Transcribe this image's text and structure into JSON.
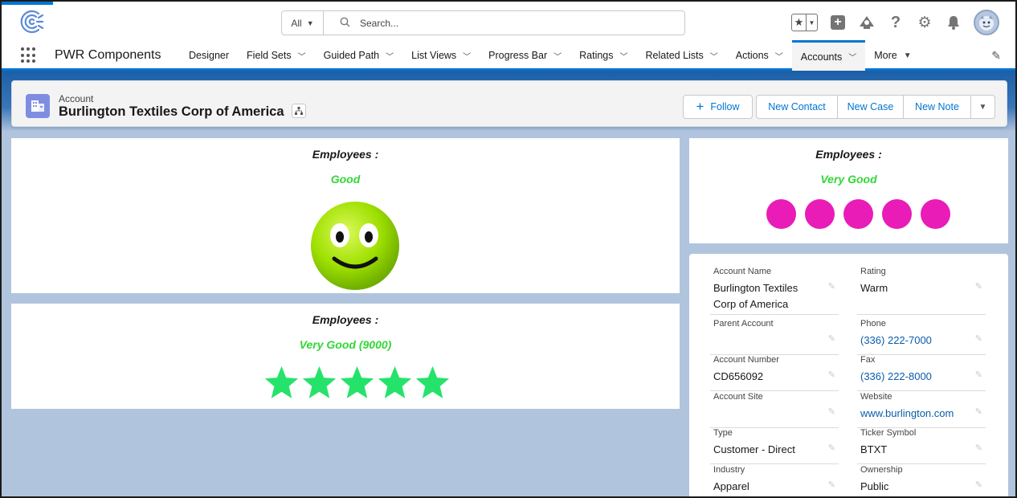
{
  "search": {
    "scope": "All",
    "placeholder": "Search..."
  },
  "app": {
    "name": "PWR Components",
    "nav": [
      {
        "label": "Designer",
        "has_menu": false
      },
      {
        "label": "Field Sets",
        "has_menu": true
      },
      {
        "label": "Guided Path",
        "has_menu": true
      },
      {
        "label": "List Views",
        "has_menu": true
      },
      {
        "label": "Progress Bar",
        "has_menu": true
      },
      {
        "label": "Ratings",
        "has_menu": true
      },
      {
        "label": "Related Lists",
        "has_menu": true
      },
      {
        "label": "Actions",
        "has_menu": true
      },
      {
        "label": "Accounts",
        "has_menu": true,
        "active": true
      },
      {
        "label": "More",
        "has_menu": true
      }
    ]
  },
  "record": {
    "object_label": "Account",
    "name": "Burlington Textiles Corp of America",
    "actions": {
      "follow": "Follow",
      "new_contact": "New Contact",
      "new_case": "New Case",
      "new_note": "New Note"
    }
  },
  "ratings": {
    "smiley": {
      "title": "Employees :",
      "value": "Good"
    },
    "stars": {
      "title": "Employees :",
      "value": "Very Good (9000)",
      "count": 5
    },
    "circles": {
      "title": "Employees :",
      "value": "Very Good",
      "count": 5
    }
  },
  "details": {
    "fields": [
      {
        "label": "Account Name",
        "value": "Burlington Textiles Corp of America",
        "link": false
      },
      {
        "label": "Rating",
        "value": "Warm",
        "link": false
      },
      {
        "label": "Parent Account",
        "value": "",
        "link": false
      },
      {
        "label": "Phone",
        "value": "(336) 222-7000",
        "link": true
      },
      {
        "label": "Account Number",
        "value": "CD656092",
        "link": false
      },
      {
        "label": "Fax",
        "value": "(336) 222-8000",
        "link": true
      },
      {
        "label": "Account Site",
        "value": "",
        "link": false
      },
      {
        "label": "Website",
        "value": "www.burlington.com",
        "link": true
      },
      {
        "label": "Type",
        "value": "Customer - Direct",
        "link": false
      },
      {
        "label": "Ticker Symbol",
        "value": "BTXT",
        "link": false
      },
      {
        "label": "Industry",
        "value": "Apparel",
        "link": false
      },
      {
        "label": "Ownership",
        "value": "Public",
        "link": false
      }
    ]
  },
  "colors": {
    "brand": "#0176d3",
    "rating_text": "#32d636",
    "star": "#25e36a",
    "circle": "#e91cb8",
    "smiley": "#8fd400"
  },
  "icons": [
    "app-logo-icon",
    "search-icon",
    "favorites-star-icon",
    "global-add-icon",
    "trailhead-icon",
    "help-icon",
    "setup-gear-icon",
    "notifications-bell-icon",
    "user-avatar",
    "app-launcher-icon",
    "edit-nav-icon",
    "account-object-icon",
    "hierarchy-icon",
    "add-icon",
    "chevron-down-icon",
    "smiley-face-icon",
    "star-icon",
    "pencil-icon"
  ]
}
